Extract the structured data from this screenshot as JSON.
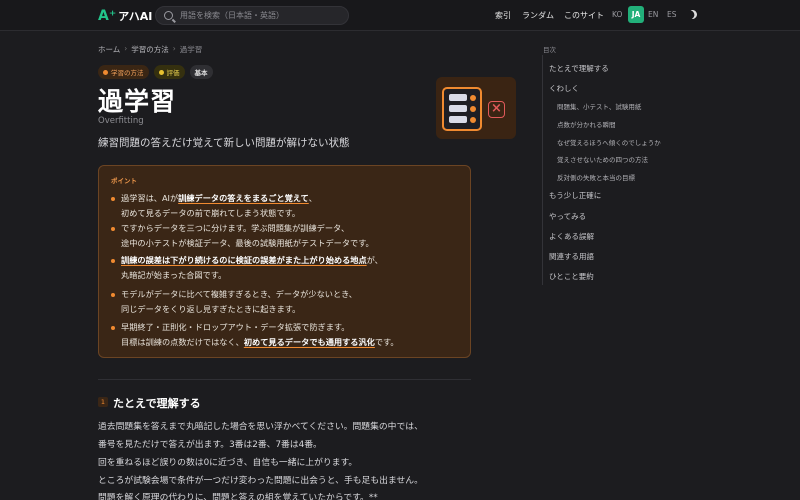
{
  "header": {
    "logo_mark": "A⁺",
    "logo_text": "アハAI",
    "search_placeholder": "用語を検索（日本語・英語）",
    "nav": [
      "索引",
      "ランダム",
      "このサイト"
    ],
    "langs": [
      "KO",
      "JA",
      "EN",
      "ES"
    ],
    "active_lang": "JA"
  },
  "breadcrumb": [
    "ホーム",
    "学習の方法",
    "過学習"
  ],
  "tags": [
    {
      "label": "学習の方法",
      "color": "#f08a30"
    },
    {
      "label": "評価",
      "color": "#e8c230"
    },
    {
      "label": "基本"
    }
  ],
  "title": "過学習",
  "subtitle": "Overfitting",
  "lead": "練習問題の答えだけ覚えて新しい問題が解けない状態",
  "point": {
    "label": "ポイント",
    "items": [
      {
        "l1a": "過学習は、AIが",
        "l1em": "訓練データの答えをまるごと覚えて",
        "l1b": "、",
        "l2": "初めて見るデータの前で崩れてしまう状態です。"
      },
      {
        "l1a": "ですからデータを三つに分けます。学ぶ問題集が訓練データ、",
        "l1em": "",
        "l1b": "",
        "l2": "途中の小テストが検証データ、最後の試験用紙がテストデータです。"
      },
      {
        "l1a": "",
        "l1em": "訓練の誤差は下がり続けるのに検証の誤差がまた上がり始める地点",
        "l1b": "が、",
        "l2": "丸暗記が始まった合図です。"
      },
      {
        "l1a": "モデルがデータに比べて複雑すぎるとき、データが少ないとき、",
        "l1em": "",
        "l1b": "",
        "l2": "同じデータをくり返し見すぎたときに起きます。"
      },
      {
        "l1a": "早期終了・正則化・ドロップアウト・データ拡張で防ぎます。",
        "l1em": "",
        "l1b": "",
        "l2a": "目標は訓練の点数だけではなく、",
        "l2em": "初めて見るデータでも通用する汎化",
        "l2b": "です。"
      }
    ]
  },
  "section1": {
    "num": "1",
    "title": "たとえで理解する",
    "paragraphs": [
      "過去問題集を答えまで丸暗記した場合を思い浮かべてください。問題集の中では、",
      "番号を見ただけで答えが出ます。3番は2番、7番は4番。",
      "回を重ねるほど誤りの数は0に近づき、自信も一緒に上がります。",
      "ところが試験会場で条件が一つだけ変わった問題に出会うと、手も足も出ません。",
      "問題を解く原理の代わりに、問題と答えの組を覚えていたからです。**"
    ]
  },
  "toc": {
    "title": "目次",
    "items": [
      {
        "label": "たとえで理解する",
        "sub": false
      },
      {
        "label": "くわしく",
        "sub": false
      },
      {
        "label": "問題集、小テスト、試験用紙",
        "sub": true
      },
      {
        "label": "点数が分かれる瞬間",
        "sub": true
      },
      {
        "label": "なぜ覚えるほうへ傾くのでしょうか",
        "sub": true
      },
      {
        "label": "覚えさせないための四つの方法",
        "sub": true
      },
      {
        "label": "反対側の失敗と本当の目標",
        "sub": true
      },
      {
        "label": "もう少し正確に",
        "sub": false
      },
      {
        "label": "やってみる",
        "sub": false
      },
      {
        "label": "よくある誤解",
        "sub": false
      },
      {
        "label": "関連する用語",
        "sub": false
      },
      {
        "label": "ひとこと要約",
        "sub": false
      }
    ]
  },
  "colors": {
    "accent": "#f08a30",
    "brand": "#22b07a",
    "background": "#1c1c1f"
  }
}
